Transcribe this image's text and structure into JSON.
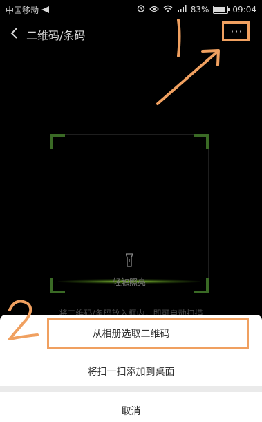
{
  "status_bar": {
    "carrier": "中国移动",
    "battery": "83%",
    "battery_level": 0.83,
    "time": "09:04",
    "icons": [
      "navigation-icon",
      "alarm-icon",
      "eye-icon",
      "wifi-icon",
      "signal-icon",
      "battery-icon"
    ]
  },
  "header": {
    "title": "二维码/条码",
    "more_label": "···"
  },
  "scanner": {
    "torch_label": "轻触照亮",
    "hint": "将二维码/条码放入框内，即可自动扫描"
  },
  "sheet": {
    "items": [
      {
        "label": "从相册选取二维码"
      },
      {
        "label": "将扫一扫添加到桌面"
      },
      {
        "label": "取消"
      }
    ]
  },
  "colors": {
    "annotation": "#f0a060",
    "scanner_green": "#3a6a25"
  }
}
